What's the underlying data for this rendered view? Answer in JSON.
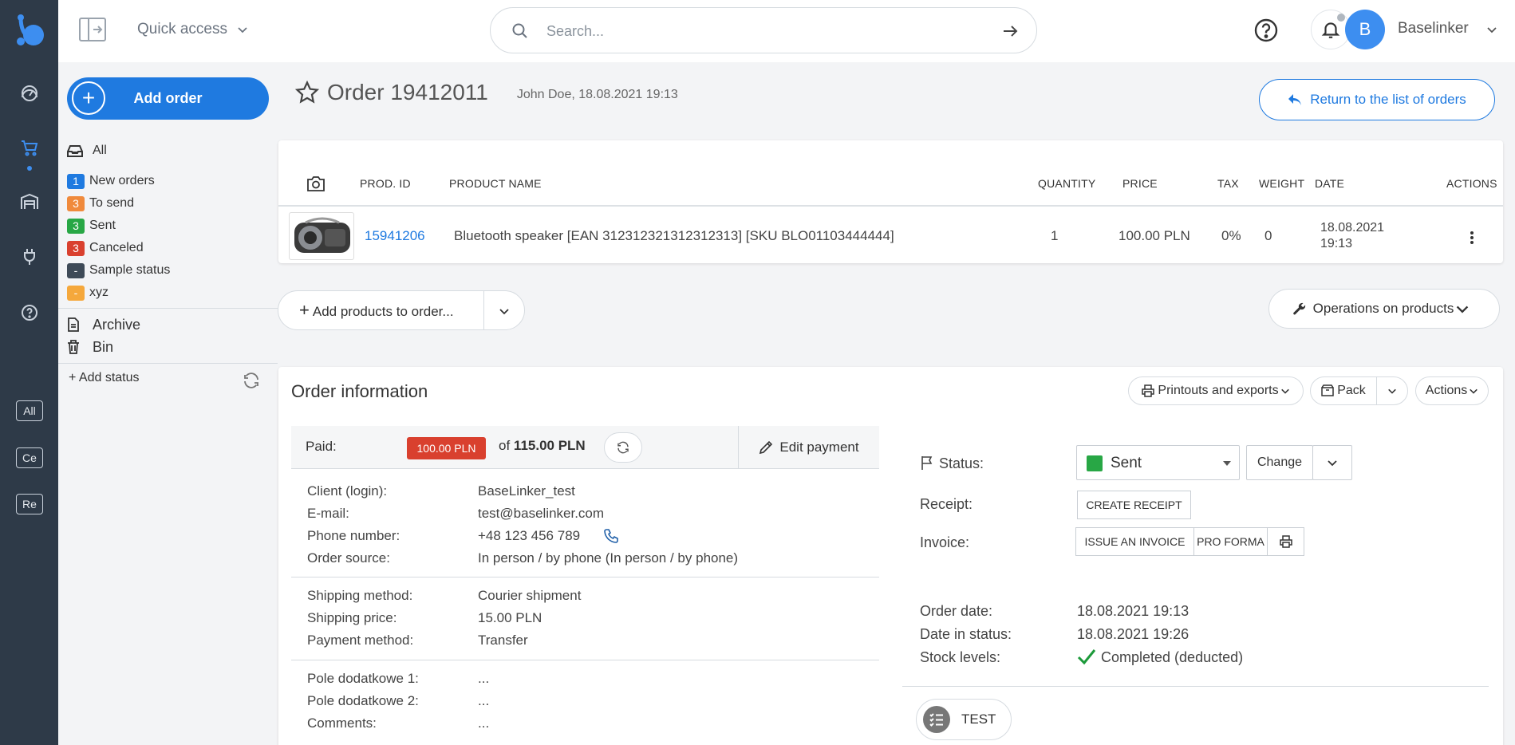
{
  "topbar": {
    "quick_access": "Quick access",
    "search_placeholder": "Search...",
    "avatar_letter": "B",
    "user_name": "Baselinker"
  },
  "rail": {
    "tags": [
      "All",
      "Ce",
      "Re"
    ]
  },
  "sidebar": {
    "add_order": "Add order",
    "all": "All",
    "statuses": [
      {
        "count": "1",
        "label": "New orders",
        "color": "#1f7ae0"
      },
      {
        "count": "3",
        "label": "To send",
        "color": "#f08a3c"
      },
      {
        "count": "3",
        "label": "Sent",
        "color": "#28a745"
      },
      {
        "count": "3",
        "label": "Canceled",
        "color": "#d9402e"
      },
      {
        "count": "-",
        "label": "Sample status",
        "color": "#3e4a57"
      },
      {
        "count": "-",
        "label": "xyz",
        "color": "#f5a83c"
      }
    ],
    "archive": "Archive",
    "bin": "Bin",
    "add_status": "+ Add status"
  },
  "order": {
    "title": "Order 19412011",
    "meta": "John Doe, 18.08.2021 19:13",
    "return_label": "Return to the list of orders"
  },
  "products": {
    "headers": {
      "prod_id": "PROD. ID",
      "name": "PRODUCT NAME",
      "quantity": "QUANTITY",
      "price": "PRICE",
      "tax": "TAX",
      "weight": "WEIGHT",
      "date": "DATE",
      "actions": "ACTIONS"
    },
    "rows": [
      {
        "prod_id": "15941206",
        "name": "Bluetooth speaker [EAN 312312321312312313] [SKU BLO01103444444]",
        "quantity": "1",
        "price": "100.00 PLN",
        "tax": "0%",
        "weight": "0",
        "date_line1": "18.08.2021",
        "date_line2": "19:13"
      }
    ],
    "add_products": "Add products to order...",
    "operations": "Operations on products"
  },
  "info": {
    "title": "Order information",
    "printouts": "Printouts and exports",
    "pack": "Pack",
    "actions": "Actions",
    "paid_label": "Paid:",
    "paid_amount": "100.00 PLN",
    "of_text": "of",
    "total": "115.00 PLN",
    "edit_payment": "Edit payment",
    "client": [
      {
        "label": "Client (login):",
        "value": "BaseLinker_test"
      },
      {
        "label": "E-mail:",
        "value": "test@baselinker.com"
      },
      {
        "label": "Phone number:",
        "value": "+48 123 456 789"
      },
      {
        "label": "Order source:",
        "value": "In person / by phone (In person / by phone)"
      }
    ],
    "shipping": [
      {
        "label": "Shipping method:",
        "value": "Courier shipment"
      },
      {
        "label": "Shipping price:",
        "value": "15.00 PLN"
      },
      {
        "label": "Payment method:",
        "value": "Transfer"
      }
    ],
    "extra": [
      {
        "label": "Pole dodatkowe 1:",
        "value": "..."
      },
      {
        "label": "Pole dodatkowe 2:",
        "value": "..."
      },
      {
        "label": "Comments:",
        "value": "..."
      }
    ],
    "status_label": "Status:",
    "status_value": "Sent",
    "change": "Change",
    "receipt_label": "Receipt:",
    "create_receipt": "CREATE RECEIPT",
    "invoice_label": "Invoice:",
    "issue_invoice": "ISSUE AN INVOICE",
    "pro_forma": "PRO FORMA",
    "order_date_label": "Order date:",
    "order_date": "18.08.2021 19:13",
    "date_in_status_label": "Date in status:",
    "date_in_status": "18.08.2021 19:26",
    "stock_label": "Stock levels:",
    "stock_value": "Completed (deducted)",
    "test": "TEST"
  }
}
